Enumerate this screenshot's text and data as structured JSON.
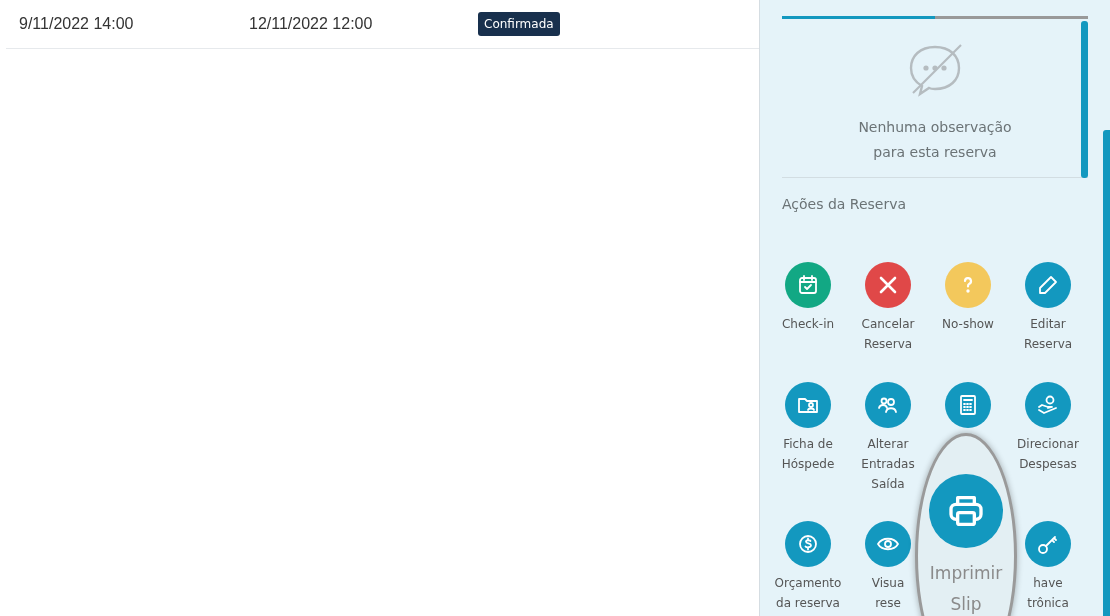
{
  "table": {
    "rows": [
      {
        "check_in": "9/11/2022 14:00",
        "check_out": "12/11/2022 12:00",
        "status": "Confirmada"
      }
    ]
  },
  "panel": {
    "tabs": [
      {
        "selected": true
      },
      {
        "selected": false
      }
    ],
    "notes": {
      "empty_text": "Nenhuma observação para esta reserva"
    },
    "actions_title": "Ações da Reserva",
    "actions": [
      {
        "kind": "checkin",
        "lines": [
          "Check-in"
        ]
      },
      {
        "kind": "cancel",
        "lines": [
          "Cancelar",
          "Reserva"
        ]
      },
      {
        "kind": "noshow",
        "lines": [
          "No-show"
        ]
      },
      {
        "kind": "edit",
        "lines": [
          "Editar",
          "Reserva"
        ]
      },
      {
        "kind": "guest",
        "lines": [
          "Ficha de",
          "Hóspede"
        ]
      },
      {
        "kind": "people",
        "lines": [
          "Alterar",
          "Entradas",
          "Saída"
        ]
      },
      {
        "kind": "calculator"
      },
      {
        "kind": "money-hand",
        "lines": [
          "Direcionar",
          "Despesas"
        ]
      },
      {
        "kind": "dollar",
        "lines": [
          "Orçamento",
          "da reserva"
        ]
      },
      {
        "kind": "eye",
        "lines": [
          "Visua",
          "rese"
        ]
      },
      {
        "kind": "hidden"
      },
      {
        "kind": "key",
        "lines": [
          "have",
          "trônica"
        ]
      }
    ],
    "magnifier": {
      "label": "Imprimir Slip"
    }
  }
}
